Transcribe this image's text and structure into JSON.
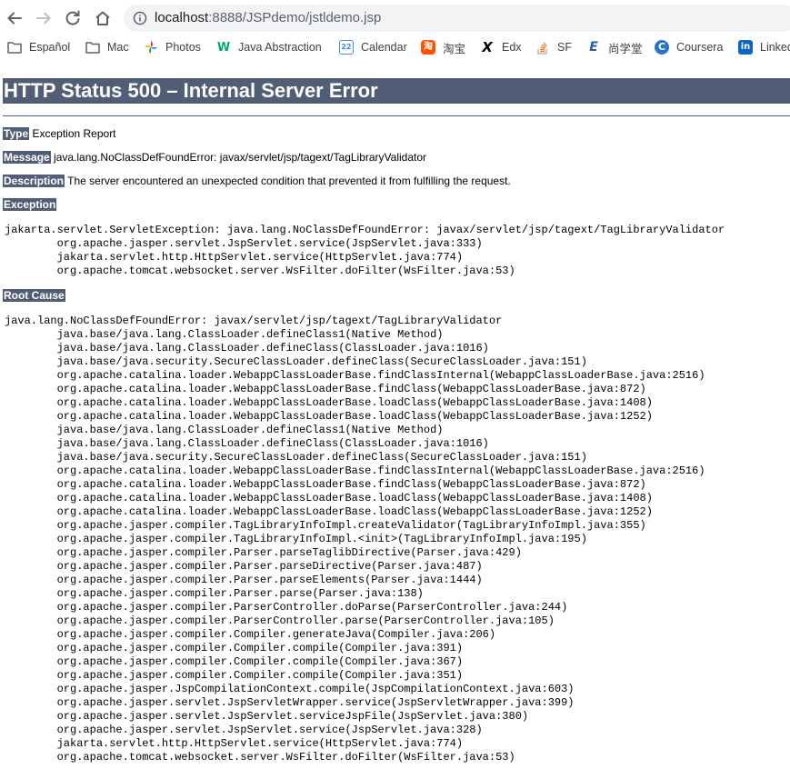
{
  "browser": {
    "url_host": "localhost",
    "url_path": ":8888/JSPdemo/jstldemo.jsp",
    "bookmarks": [
      {
        "label": "Español",
        "icon": "folder-icon"
      },
      {
        "label": "Mac",
        "icon": "folder-icon"
      },
      {
        "label": "Photos",
        "icon": "google-photos-icon"
      },
      {
        "label": "Java Abstraction",
        "icon": "w3schools-icon"
      },
      {
        "label": "Calendar",
        "icon": "calendar-icon"
      },
      {
        "label": "淘宝",
        "icon": "taobao-icon"
      },
      {
        "label": "Edx",
        "icon": "edx-icon"
      },
      {
        "label": "SF",
        "icon": "stackoverflow-icon"
      },
      {
        "label": "尚学堂",
        "icon": "shangxuetang-icon"
      },
      {
        "label": "Coursera",
        "icon": "coursera-icon"
      },
      {
        "label": "Linked",
        "icon": "linkedin-icon"
      }
    ]
  },
  "page": {
    "title": "HTTP Status 500 – Internal Server Error",
    "type_label": "Type",
    "type_value": "Exception Report",
    "message_label": "Message",
    "message_value": "java.lang.NoClassDefFoundError: javax/servlet/jsp/tagext/TagLibraryValidator",
    "description_label": "Description",
    "description_value": "The server encountered an unexpected condition that prevented it from fulfilling the request.",
    "exception_label": "Exception",
    "exception_trace": "jakarta.servlet.ServletException: java.lang.NoClassDefFoundError: javax/servlet/jsp/tagext/TagLibraryValidator\n\torg.apache.jasper.servlet.JspServlet.service(JspServlet.java:333)\n\tjakarta.servlet.http.HttpServlet.service(HttpServlet.java:774)\n\torg.apache.tomcat.websocket.server.WsFilter.doFilter(WsFilter.java:53)",
    "root_cause_label": "Root Cause",
    "root_cause_trace": "java.lang.NoClassDefFoundError: javax/servlet/jsp/tagext/TagLibraryValidator\n\tjava.base/java.lang.ClassLoader.defineClass1(Native Method)\n\tjava.base/java.lang.ClassLoader.defineClass(ClassLoader.java:1016)\n\tjava.base/java.security.SecureClassLoader.defineClass(SecureClassLoader.java:151)\n\torg.apache.catalina.loader.WebappClassLoaderBase.findClassInternal(WebappClassLoaderBase.java:2516)\n\torg.apache.catalina.loader.WebappClassLoaderBase.findClass(WebappClassLoaderBase.java:872)\n\torg.apache.catalina.loader.WebappClassLoaderBase.loadClass(WebappClassLoaderBase.java:1408)\n\torg.apache.catalina.loader.WebappClassLoaderBase.loadClass(WebappClassLoaderBase.java:1252)\n\tjava.base/java.lang.ClassLoader.defineClass1(Native Method)\n\tjava.base/java.lang.ClassLoader.defineClass(ClassLoader.java:1016)\n\tjava.base/java.security.SecureClassLoader.defineClass(SecureClassLoader.java:151)\n\torg.apache.catalina.loader.WebappClassLoaderBase.findClassInternal(WebappClassLoaderBase.java:2516)\n\torg.apache.catalina.loader.WebappClassLoaderBase.findClass(WebappClassLoaderBase.java:872)\n\torg.apache.catalina.loader.WebappClassLoaderBase.loadClass(WebappClassLoaderBase.java:1408)\n\torg.apache.catalina.loader.WebappClassLoaderBase.loadClass(WebappClassLoaderBase.java:1252)\n\torg.apache.jasper.compiler.TagLibraryInfoImpl.createValidator(TagLibraryInfoImpl.java:355)\n\torg.apache.jasper.compiler.TagLibraryInfoImpl.<init>(TagLibraryInfoImpl.java:195)\n\torg.apache.jasper.compiler.Parser.parseTaglibDirective(Parser.java:429)\n\torg.apache.jasper.compiler.Parser.parseDirective(Parser.java:487)\n\torg.apache.jasper.compiler.Parser.parseElements(Parser.java:1444)\n\torg.apache.jasper.compiler.Parser.parse(Parser.java:138)\n\torg.apache.jasper.compiler.ParserController.doParse(ParserController.java:244)\n\torg.apache.jasper.compiler.ParserController.parse(ParserController.java:105)\n\torg.apache.jasper.compiler.Compiler.generateJava(Compiler.java:206)\n\torg.apache.jasper.compiler.Compiler.compile(Compiler.java:391)\n\torg.apache.jasper.compiler.Compiler.compile(Compiler.java:367)\n\torg.apache.jasper.compiler.Compiler.compile(Compiler.java:351)\n\torg.apache.jasper.JspCompilationContext.compile(JspCompilationContext.java:603)\n\torg.apache.jasper.servlet.JspServletWrapper.service(JspServletWrapper.java:399)\n\torg.apache.jasper.servlet.JspServlet.serviceJspFile(JspServlet.java:380)\n\torg.apache.jasper.servlet.JspServlet.service(JspServlet.java:328)\n\tjakarta.servlet.http.HttpServlet.service(HttpServlet.java:774)\n\torg.apache.tomcat.websocket.server.WsFilter.doFilter(WsFilter.java:53)"
  },
  "colors": {
    "header_bg": "#525d76",
    "header_text": "#ffffff"
  }
}
